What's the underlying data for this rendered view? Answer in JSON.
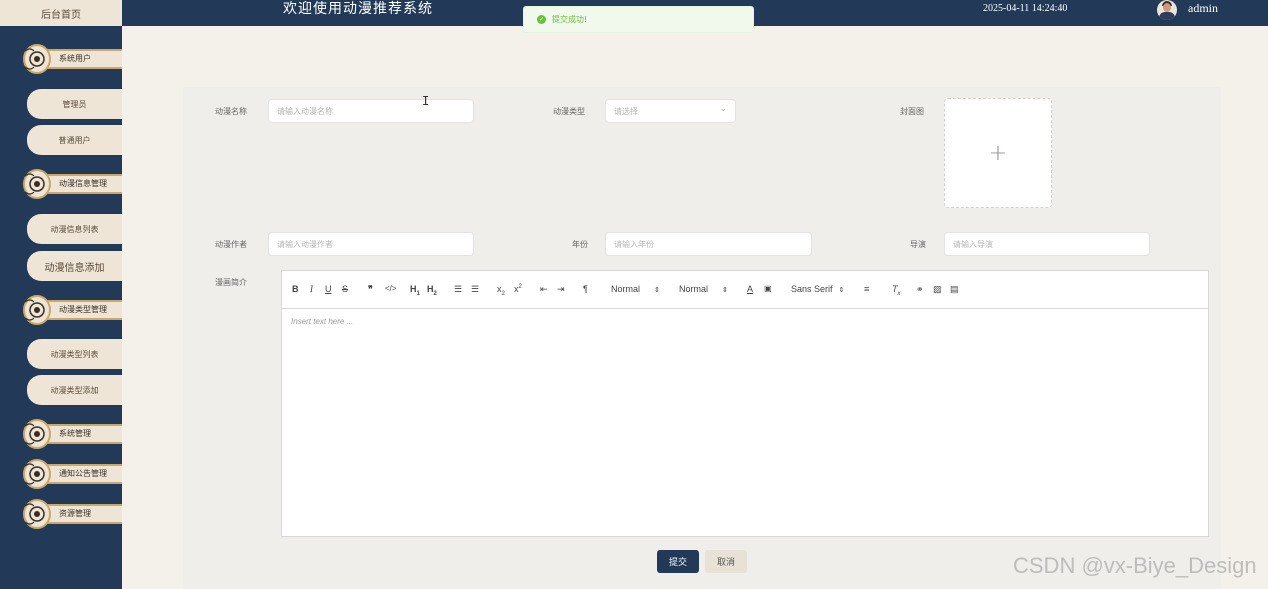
{
  "header": {
    "home_tab": "后台首页",
    "title": "欢迎使用动漫推荐系统",
    "datetime": "2025-04-11 14:24:40",
    "username": "admin"
  },
  "toast": {
    "message": "提交成功!"
  },
  "sidebar": {
    "groups": [
      {
        "label": "系统用户",
        "items": [
          "管理员",
          "普通用户"
        ]
      },
      {
        "label": "动漫信息管理",
        "items": [
          "动漫信息列表",
          "动漫信息添加"
        ]
      },
      {
        "label": "动漫类型管理",
        "items": [
          "动漫类型列表",
          "动漫类型添加"
        ]
      },
      {
        "label": "系统管理",
        "items": []
      },
      {
        "label": "通知公告管理",
        "items": []
      },
      {
        "label": "资源管理",
        "items": []
      }
    ]
  },
  "form": {
    "name_label": "动漫名称",
    "name_placeholder": "请输入动漫名称",
    "type_label": "动漫类型",
    "type_placeholder": "请选择",
    "cover_label": "封面图",
    "author_label": "动漫作者",
    "author_placeholder": "请输入动漫作者",
    "year_label": "年份",
    "year_placeholder": "请输入年份",
    "director_label": "导演",
    "director_placeholder": "请输入导演",
    "intro_label": "漫画简介",
    "editor": {
      "header_dropdown": "Normal",
      "size_dropdown": "Normal",
      "font_dropdown": "Sans Serif",
      "placeholder": "Insert text here ..."
    },
    "submit_label": "提交",
    "cancel_label": "取消"
  },
  "watermark": "CSDN @vx-Biye_Design",
  "colors": {
    "header_bg": "#223a57",
    "sidebar_bg": "#223a57",
    "menu_bg": "#efe5d6",
    "accent_gold": "#c9a86a",
    "success": "#67c23a",
    "page_bg": "#f3f1ea"
  }
}
